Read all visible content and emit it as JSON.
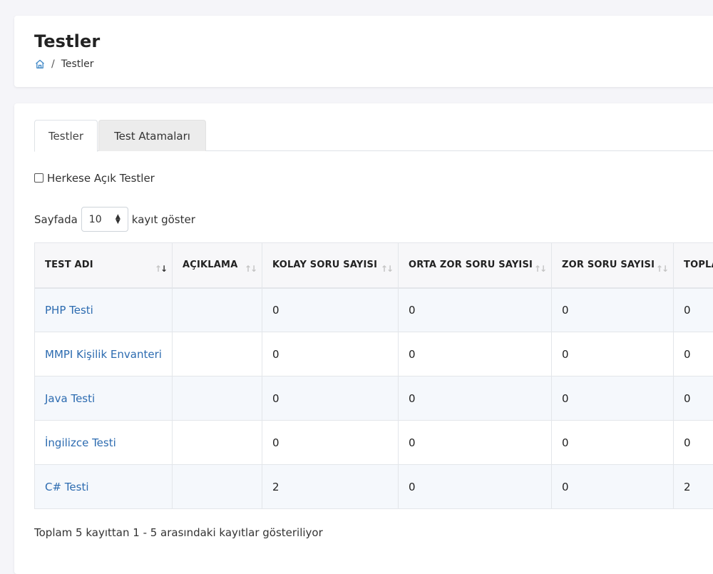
{
  "page": {
    "title": "Testler",
    "breadcrumb": {
      "home_icon": "home-icon",
      "current": "Testler",
      "separator": "/"
    }
  },
  "tabs": [
    {
      "label": "Testler",
      "active": true
    },
    {
      "label": "Test Atamaları",
      "active": false
    }
  ],
  "filter": {
    "public_tests_label": "Herkese Açık Testler",
    "checked": false
  },
  "length": {
    "prefix": "Sayfada",
    "value": "10",
    "suffix": "kayıt göster"
  },
  "table": {
    "columns": [
      "TEST ADI",
      "AÇIKLAMA",
      "KOLAY SORU SAYISI",
      "ORTA ZOR SORU SAYISI",
      "ZOR SORU SAYISI",
      "TOPLA"
    ],
    "rows": [
      {
        "name": "PHP Testi",
        "description": "",
        "easy": "0",
        "medium": "0",
        "hard": "0",
        "total": "0"
      },
      {
        "name": "MMPI Kişilik Envanteri",
        "description": "",
        "easy": "0",
        "medium": "0",
        "hard": "0",
        "total": "0"
      },
      {
        "name": "Java Testi",
        "description": "",
        "easy": "0",
        "medium": "0",
        "hard": "0",
        "total": "0"
      },
      {
        "name": "İngilizce Testi",
        "description": "",
        "easy": "0",
        "medium": "0",
        "hard": "0",
        "total": "0"
      },
      {
        "name": "C# Testi",
        "description": "",
        "easy": "2",
        "medium": "0",
        "hard": "0",
        "total": "2"
      }
    ]
  },
  "info": "Toplam 5 kayıttan 1 - 5 arasındaki kayıtlar gösteriliyor",
  "colors": {
    "link": "#2c6bb0",
    "stripe": "#f5f8fc",
    "page_bg": "#f5f5f9"
  }
}
